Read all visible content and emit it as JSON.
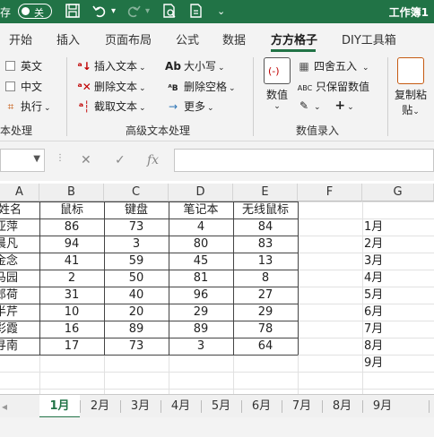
{
  "titlebar": {
    "autosave_label": "存",
    "toggle_label": "关",
    "workbook_name": "工作簿1"
  },
  "tabs": [
    {
      "label": "开始"
    },
    {
      "label": "插入"
    },
    {
      "label": "页面布局"
    },
    {
      "label": "公式"
    },
    {
      "label": "数据"
    },
    {
      "label": "方方格子"
    },
    {
      "label": "DIY工具箱"
    }
  ],
  "ribbon": {
    "group1_items": [
      "英文",
      "中文",
      "执行"
    ],
    "group1_label": "本处理",
    "group2_items": [
      "插入文本",
      "删除文本",
      "截取文本",
      "大小写",
      "删除空格",
      "更多"
    ],
    "group2_label": "高级文本处理",
    "data_btn_label": "数值",
    "round_label": "四舍五入",
    "keep_values_label": "只保留数值",
    "group3_label": "数值录入",
    "copy_paste_label": [
      "复制粘",
      "贴"
    ]
  },
  "formula": {
    "fx_label": "fx"
  },
  "columns": [
    "A",
    "B",
    "C",
    "D",
    "E",
    "F",
    "G"
  ],
  "table": {
    "headers": [
      "姓名",
      "鼠标",
      "键盘",
      "笔记本",
      "无线鼠标"
    ],
    "rows": [
      [
        "亚萍",
        "86",
        "73",
        "4",
        "84"
      ],
      [
        "晨凡",
        "94",
        "3",
        "80",
        "83"
      ],
      [
        "金念",
        "41",
        "59",
        "45",
        "13"
      ],
      [
        "马园",
        "2",
        "50",
        "81",
        "8"
      ],
      [
        "郎荷",
        "31",
        "40",
        "96",
        "27"
      ],
      [
        "半芹",
        "10",
        "20",
        "29",
        "29"
      ],
      [
        "彩霞",
        "16",
        "89",
        "89",
        "78"
      ],
      [
        "寻南",
        "17",
        "73",
        "3",
        "64"
      ]
    ]
  },
  "month_list": [
    "1月",
    "2月",
    "3月",
    "4月",
    "5月",
    "6月",
    "7月",
    "8月",
    "9月"
  ],
  "sheet_tabs": [
    {
      "label": "1月",
      "active": true
    },
    {
      "label": "2月"
    },
    {
      "label": "3月"
    },
    {
      "label": "4月"
    },
    {
      "label": "5月"
    },
    {
      "label": "6月"
    },
    {
      "label": "7月"
    },
    {
      "label": "8月"
    },
    {
      "label": "9月"
    }
  ],
  "colors": {
    "accent": "#217346"
  }
}
